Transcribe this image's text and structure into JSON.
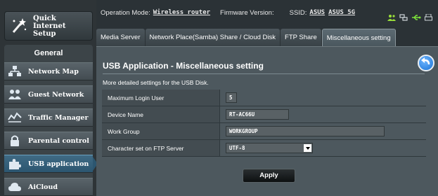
{
  "sidebar": {
    "quick_internet_setup": "Quick Internet Setup",
    "general_title": "General",
    "items": [
      {
        "label": "Network Map",
        "icon": "network-map-icon"
      },
      {
        "label": "Guest Network",
        "icon": "guest-network-icon"
      },
      {
        "label": "Traffic Manager",
        "icon": "traffic-manager-icon"
      },
      {
        "label": "Parental control",
        "icon": "lock-icon"
      },
      {
        "label": "USB application",
        "icon": "puzzle-icon"
      },
      {
        "label": "AiCloud",
        "icon": "cloud-icon"
      }
    ],
    "active_index": 4
  },
  "status": {
    "operation_mode_label": "Operation Mode:",
    "operation_mode_value": "Wireless router",
    "firmware_label": "Firmware Version:",
    "ssid_label": "SSID:",
    "ssid_1": "ASUS",
    "ssid_2": "ASUS_5G",
    "icons": [
      "user-icon",
      "network-icon",
      "usb-icon",
      "printer-icon"
    ]
  },
  "tabs": [
    {
      "label": "Media Server"
    },
    {
      "label": "Network Place(Samba) Share / Cloud Disk"
    },
    {
      "label": "FTP Share"
    },
    {
      "label": "Miscellaneous setting"
    }
  ],
  "active_tab": 3,
  "main": {
    "title": "USB Application - Miscellaneous setting",
    "description": "More detailed settings for the USB Disk.",
    "fields": {
      "max_login_label": "Maximum Login User",
      "max_login_value": "5",
      "device_name_label": "Device Name",
      "device_name_value": "RT-AC66U",
      "work_group_label": "Work Group",
      "work_group_value": "WORKGROUP",
      "charset_label": "Character set on FTP Server",
      "charset_value": "UTF-8"
    },
    "apply_label": "Apply"
  }
}
